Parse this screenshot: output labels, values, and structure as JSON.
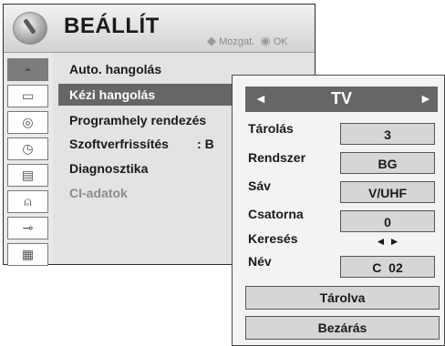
{
  "menu": {
    "title": "BEÁLLÍT",
    "hint_move_glyph": "◆",
    "hint_move": "Mozgat.",
    "hint_ok_glyph": "◉",
    "hint_ok": "OK",
    "sidebar_icons": [
      "satellite-dish-icon",
      "tv-screen-icon",
      "speaker-icon",
      "clock-icon",
      "lock-icon",
      "padlock-icon",
      "plug-icon",
      "clapperboard-icon"
    ],
    "items": [
      {
        "label": "Auto. hangolás"
      },
      {
        "label": "Kézi hangolás"
      },
      {
        "label": "Programhely rendezés"
      },
      {
        "label": "Szoftverfrissítés        : B"
      },
      {
        "label": "Diagnosztika"
      },
      {
        "label": "CI-adatok"
      }
    ]
  },
  "panel": {
    "header_value": "TV",
    "left_arrow": "◄",
    "right_arrow": "►",
    "rows": [
      {
        "label": "Tárolás",
        "value": "3"
      },
      {
        "label": "Rendszer",
        "value": "BG"
      },
      {
        "label": "Sáv",
        "value": "V/UHF"
      },
      {
        "label": "Csatorna",
        "value": "0"
      },
      {
        "label": "Keresés",
        "value": "◄ ►"
      },
      {
        "label": "Név",
        "value": "C  02"
      }
    ],
    "store_button": "Tárolva",
    "close_button": "Bezárás"
  }
}
